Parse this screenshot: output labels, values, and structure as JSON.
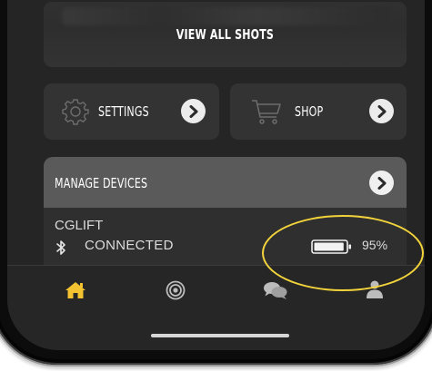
{
  "shots": {
    "view_all_label": "VIEW ALL SHOTS"
  },
  "quick_links": {
    "settings_label": "SETTINGS",
    "shop_label": "SHOP"
  },
  "devices": {
    "header_label": "MANAGE DEVICES",
    "device_name": "CGLIFT",
    "status": "CONNECTED",
    "battery_percent": "95%",
    "battery_level": 0.95
  },
  "tabbar": {
    "items": [
      {
        "icon": "home-icon",
        "active": true
      },
      {
        "icon": "target-icon",
        "active": false
      },
      {
        "icon": "chat-icon",
        "active": false
      },
      {
        "icon": "user-icon",
        "active": false
      }
    ]
  },
  "colors": {
    "accent": "#f2c230",
    "annotation": "#f2d33b",
    "card": "#333333",
    "header": "#5a5a5a",
    "background": "#252525"
  }
}
